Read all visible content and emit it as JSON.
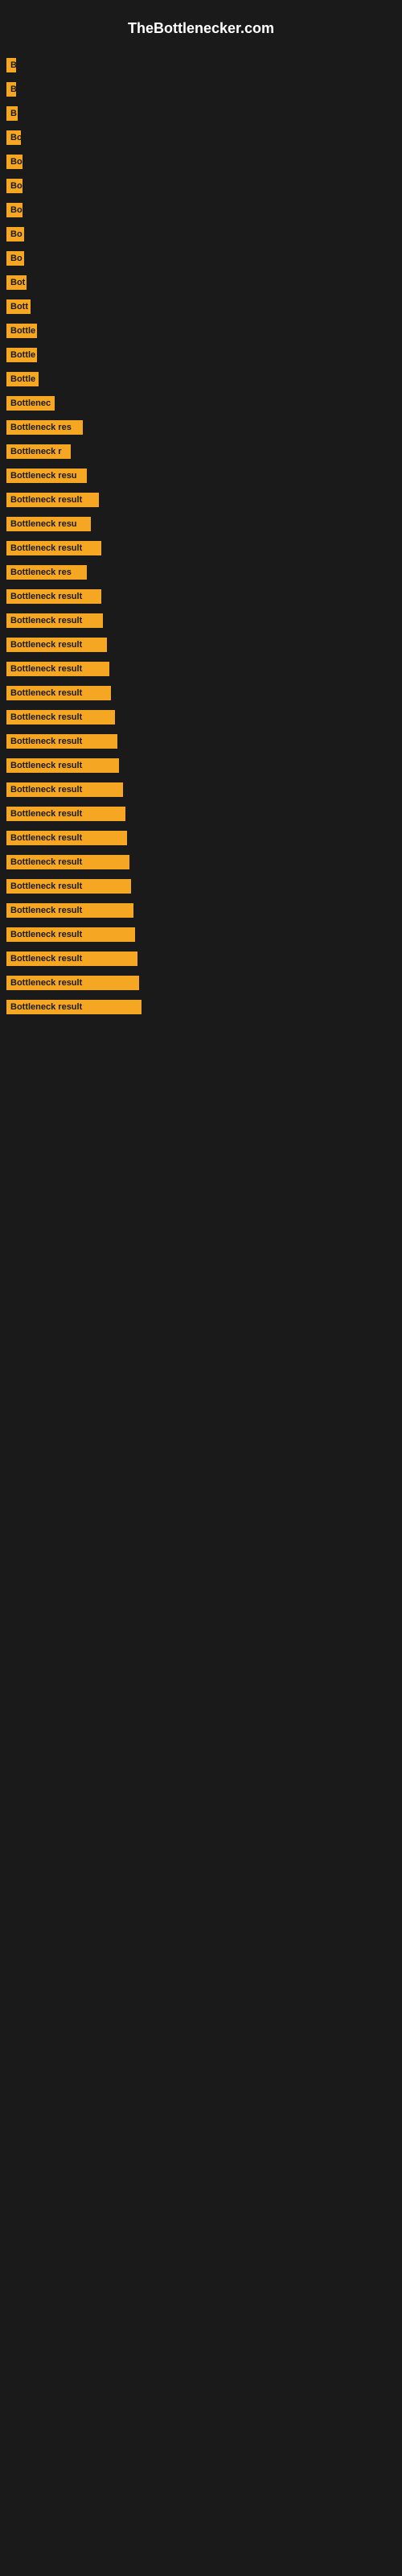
{
  "header": {
    "title": "TheBottlenecker.com"
  },
  "bars": [
    {
      "label": "B",
      "width": 12
    },
    {
      "label": "B",
      "width": 12
    },
    {
      "label": "B",
      "width": 14
    },
    {
      "label": "Bo",
      "width": 18
    },
    {
      "label": "Bo",
      "width": 20
    },
    {
      "label": "Bo",
      "width": 20
    },
    {
      "label": "Bo",
      "width": 20
    },
    {
      "label": "Bo",
      "width": 22
    },
    {
      "label": "Bo",
      "width": 22
    },
    {
      "label": "Bot",
      "width": 25
    },
    {
      "label": "Bott",
      "width": 30
    },
    {
      "label": "Bottle",
      "width": 38
    },
    {
      "label": "Bottle",
      "width": 38
    },
    {
      "label": "Bottle",
      "width": 40
    },
    {
      "label": "Bottlenec",
      "width": 60
    },
    {
      "label": "Bottleneck res",
      "width": 95
    },
    {
      "label": "Bottleneck r",
      "width": 80
    },
    {
      "label": "Bottleneck resu",
      "width": 100
    },
    {
      "label": "Bottleneck result",
      "width": 115
    },
    {
      "label": "Bottleneck resu",
      "width": 105
    },
    {
      "label": "Bottleneck result",
      "width": 118
    },
    {
      "label": "Bottleneck res",
      "width": 100
    },
    {
      "label": "Bottleneck result",
      "width": 118
    },
    {
      "label": "Bottleneck result",
      "width": 120
    },
    {
      "label": "Bottleneck result",
      "width": 125
    },
    {
      "label": "Bottleneck result",
      "width": 128
    },
    {
      "label": "Bottleneck result",
      "width": 130
    },
    {
      "label": "Bottleneck result",
      "width": 135
    },
    {
      "label": "Bottleneck result",
      "width": 138
    },
    {
      "label": "Bottleneck result",
      "width": 140
    },
    {
      "label": "Bottleneck result",
      "width": 145
    },
    {
      "label": "Bottleneck result",
      "width": 148
    },
    {
      "label": "Bottleneck result",
      "width": 150
    },
    {
      "label": "Bottleneck result",
      "width": 153
    },
    {
      "label": "Bottleneck result",
      "width": 155
    },
    {
      "label": "Bottleneck result",
      "width": 158
    },
    {
      "label": "Bottleneck result",
      "width": 160
    },
    {
      "label": "Bottleneck result",
      "width": 163
    },
    {
      "label": "Bottleneck result",
      "width": 165
    },
    {
      "label": "Bottleneck result",
      "width": 168
    }
  ]
}
